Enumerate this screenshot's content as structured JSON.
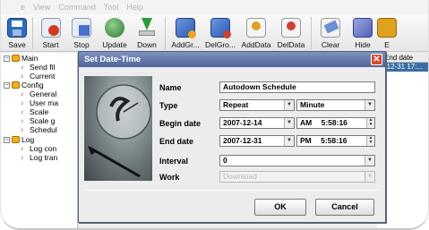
{
  "menu": [
    "e",
    "View",
    "Command",
    "Tool",
    "Help"
  ],
  "toolbar": [
    {
      "label": "Save",
      "icon": "save-icon",
      "color": "#2d6cc0"
    },
    {
      "label": "Start",
      "icon": "start-icon",
      "color": "#d23a24"
    },
    {
      "label": "Stop",
      "icon": "stop-icon",
      "color": "#4a6fd0"
    },
    {
      "label": "Update",
      "icon": "update-icon",
      "color": "#3f8a3f"
    },
    {
      "label": "Down",
      "icon": "down-icon",
      "color": "#2f9a3a"
    },
    {
      "label": "AddGr...",
      "icon": "add-group-icon",
      "color": "#4a7cd6"
    },
    {
      "label": "DelGro...",
      "icon": "delete-group-icon",
      "color": "#4a7cd6"
    },
    {
      "label": "AddData",
      "icon": "add-data-icon",
      "color": "#e0a020"
    },
    {
      "label": "DelData",
      "icon": "delete-data-icon",
      "color": "#d04030"
    },
    {
      "label": "Clear",
      "icon": "clear-icon",
      "color": "#6a8fd6"
    },
    {
      "label": "Hide",
      "icon": "hide-icon",
      "color": "#6a78c8"
    },
    {
      "label": "E",
      "icon": "exit-icon",
      "color": "#e0a020"
    }
  ],
  "tree": {
    "main": "Main",
    "main_children": [
      "Send fil",
      "Current"
    ],
    "config": "Config",
    "config_children": [
      "General",
      "User ma",
      "Scale",
      "Scale g",
      "Schedul"
    ],
    "log": "Log",
    "log_children": [
      "Log con",
      "Log tran"
    ]
  },
  "list": {
    "header": "End date",
    "selected_row": "-12-31 17:..."
  },
  "dialog": {
    "title": "Set Date-Time",
    "close": "✕",
    "name_label": "Name",
    "name_value": "Autodown Schedule",
    "type_label": "Type",
    "type_value": "Repeat",
    "unit_value": "Minute",
    "begin_label": "Begin date",
    "begin_date": "2007-12-14",
    "begin_ampm": "AM",
    "begin_time": "5:58:16",
    "end_label": "End date",
    "end_date": "2007-12-31",
    "end_ampm": "PM",
    "end_time": "5:58:16",
    "interval_label": "Interval",
    "interval_value": "0",
    "work_label": "Work",
    "work_value": "Download",
    "ok": "OK",
    "cancel": "Cancel"
  }
}
